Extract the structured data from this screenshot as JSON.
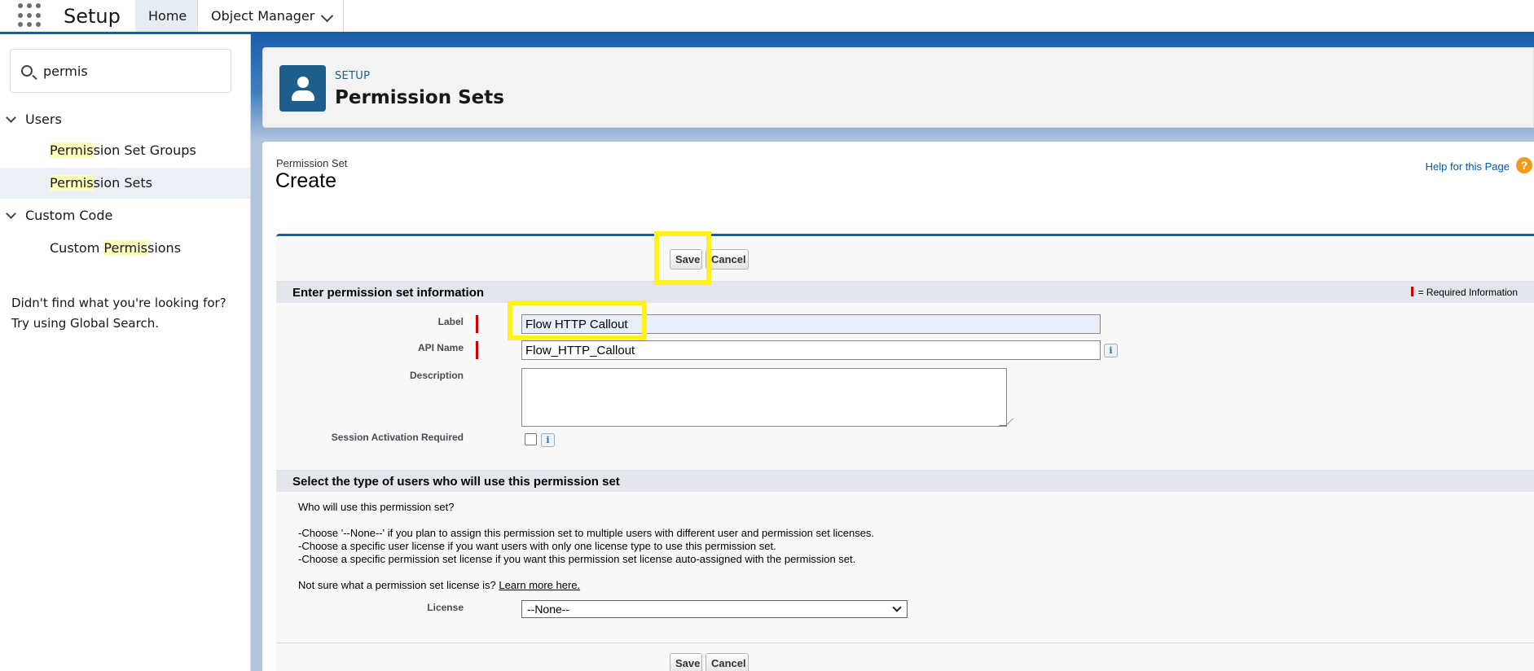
{
  "topbar": {
    "app_name": "Setup",
    "tabs": [
      {
        "label": "Home",
        "active": true
      },
      {
        "label": "Object Manager",
        "active": false
      }
    ],
    "waffle_icon": "app-launcher-icon",
    "accent_color": "#1b5faa"
  },
  "sidebar": {
    "search": {
      "value": "permis",
      "icon": "search-icon"
    },
    "groups": [
      {
        "label": "Users",
        "items": [
          {
            "highlight": "Permis",
            "rest": "sion Set Groups",
            "active": false
          },
          {
            "highlight": "Permis",
            "rest": "sion Sets",
            "active": true
          }
        ]
      },
      {
        "label": "Custom Code",
        "items": [
          {
            "pre": "Custom ",
            "highlight": "Permis",
            "rest": "sions",
            "active": false
          }
        ]
      }
    ],
    "not_found_line1": "Didn't find what you're looking for?",
    "not_found_line2": "Try using Global Search."
  },
  "header": {
    "eyebrow": "SETUP",
    "title": "Permission Sets",
    "icon": "user-icon"
  },
  "content": {
    "eyebrow": "Permission Set",
    "title": "Create",
    "help_link": "Help for this Page",
    "help_icon": "?",
    "buttons": {
      "save": "Save",
      "cancel": "Cancel"
    },
    "section1": {
      "title": "Enter permission set information",
      "required_legend": "= Required Information",
      "fields": {
        "label": {
          "label": "Label",
          "value": "Flow HTTP Callout"
        },
        "api_name": {
          "label": "API Name",
          "value": "Flow_HTTP_Callout"
        },
        "description": {
          "label": "Description",
          "value": ""
        },
        "session": {
          "label": "Session Activation Required",
          "checked": false
        }
      },
      "info_glyph": "i"
    },
    "section2": {
      "title": "Select the type of users who will use this permission set",
      "question": "Who will use this permission set?",
      "bullets": [
        "-Choose '--None--' if you plan to assign this permission set to multiple users with different user and permission set licenses.",
        "-Choose a specific user license if you want users with only one license type to use this permission set.",
        "-Choose a specific permission set license if you want this permission set license auto-assigned with the permission set."
      ],
      "not_sure": "Not sure what a permission set license is?",
      "learn_more": "Learn more here.",
      "license_label": "License",
      "license_value": "--None--"
    }
  },
  "highlight_color": "#fff21a"
}
